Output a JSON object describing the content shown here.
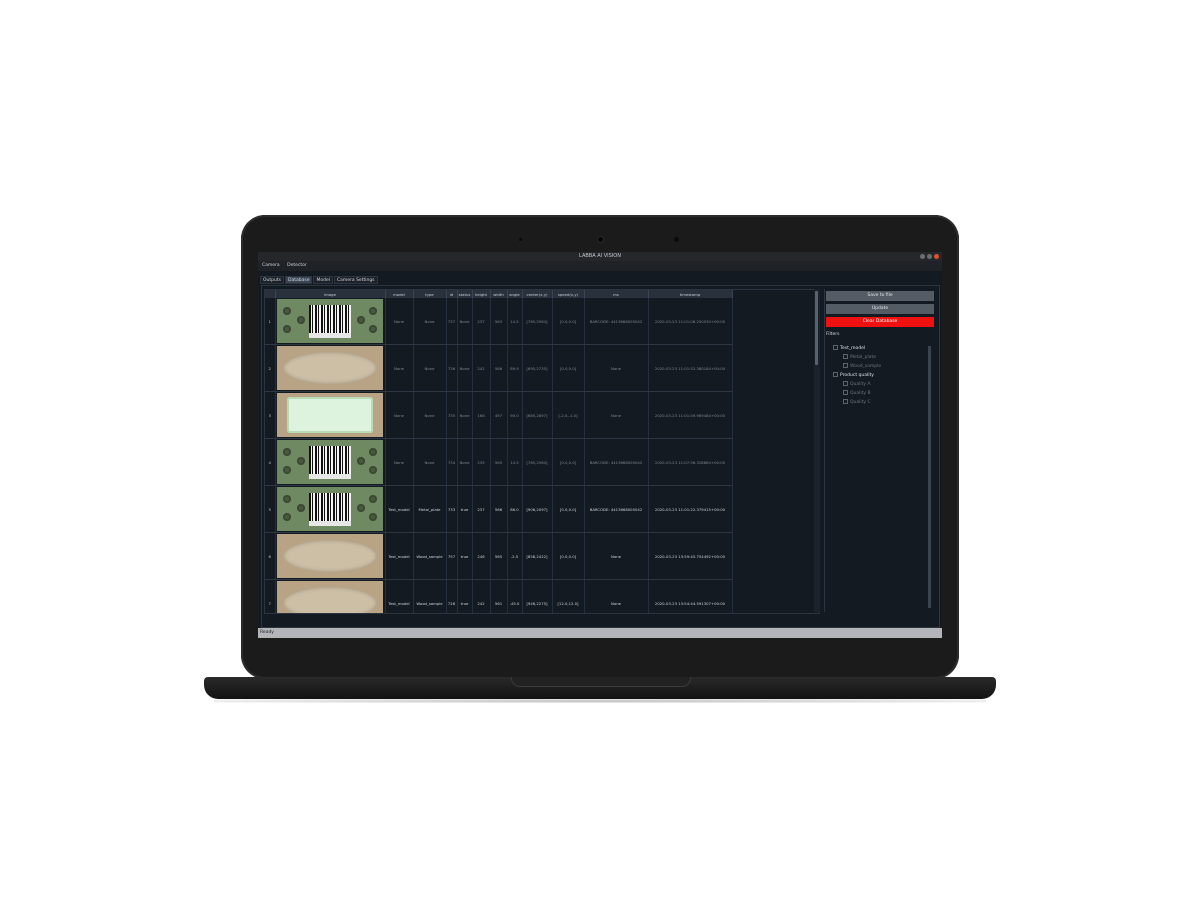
{
  "window": {
    "title": "LABBA AI VISION"
  },
  "menu": [
    "Camera",
    "Detector"
  ],
  "tabs": [
    {
      "label": "Outputs",
      "active": false
    },
    {
      "label": "Database",
      "active": true
    },
    {
      "label": "Model",
      "active": false
    },
    {
      "label": "Camera Settings",
      "active": false
    }
  ],
  "table": {
    "headers": [
      "",
      "image",
      "model",
      "type",
      "id",
      "status",
      "height",
      "width",
      "angle",
      "center(x,y)",
      "speed(x,y)",
      "ms",
      "timestamp"
    ],
    "rows": [
      {
        "n": "1",
        "img": "barcode",
        "model": "None",
        "type": "None",
        "id": "737",
        "status": "None",
        "height": "237",
        "width": "563",
        "angle": "14.5",
        "center": "[765,2564]",
        "speed": "[0.0,0.0]",
        "ms": "BARCODE: 4413668005042",
        "timestamp": "2020-03-23 11:01:06.250530+00:00"
      },
      {
        "n": "2",
        "img": "wood",
        "model": "None",
        "type": "None",
        "id": "736",
        "status": "None",
        "height": "242",
        "width": "586",
        "angle": "89.9",
        "center": "[695,2735]",
        "speed": "[0.0,0.0]",
        "ms": "None",
        "timestamp": "2020-03-23 11:01:52.380184+00:00"
      },
      {
        "n": "3",
        "img": "pale",
        "model": "None",
        "type": "None",
        "id": "735",
        "status": "None",
        "height": "168",
        "width": "497",
        "angle": "90.0",
        "center": "[685,2897]",
        "speed": "[-2.0,-1.0]",
        "ms": "None",
        "timestamp": "2020-03-23 11:01:49.969484+00:00"
      },
      {
        "n": "4",
        "img": "barcode",
        "model": "None",
        "type": "None",
        "id": "734",
        "status": "None",
        "height": "235",
        "width": "565",
        "angle": "14.5",
        "center": "[765,2564]",
        "speed": "[0.0,0.0]",
        "ms": "BARCODE: 4413668005042",
        "timestamp": "2020-03-23 11:07:56.328884+00:00"
      },
      {
        "n": "5",
        "img": "barcode",
        "model": "Test_model",
        "type": "Metal_plate",
        "id": "733",
        "status": "true",
        "height": "237",
        "width": "566",
        "angle": "86.0",
        "center": "[906,2097]",
        "speed": "[0.0,0.0]",
        "ms": "BARCODE: 4413668005042",
        "timestamp": "2020-03-23 11:01:22.379415+00:00"
      },
      {
        "n": "6",
        "img": "wood",
        "model": "Test_model",
        "type": "Wood_sample",
        "id": "757",
        "status": "true",
        "height": "246",
        "width": "565",
        "angle": "-2.5",
        "center": "[858,2422]",
        "speed": "[0.0,0.0]",
        "ms": "None",
        "timestamp": "2020-03-23 13:59:45.754492+00:00"
      },
      {
        "n": "7",
        "img": "wood",
        "model": "Test_model",
        "type": "Wood_sample",
        "id": "726",
        "status": "true",
        "height": "242",
        "width": "561",
        "angle": "-45.0",
        "center": "[946,2275]",
        "speed": "[12.0,12.0]",
        "ms": "None",
        "timestamp": "2020-03-23 13:54:44.591307+00:00"
      }
    ]
  },
  "sidebar": {
    "save_label": "Save to file",
    "update_label": "Update",
    "clear_label": "Clear Database",
    "filters_label": "Filters",
    "tree": [
      {
        "label": "Test_model",
        "children": [
          "Metal_plate",
          "Wood_sample"
        ]
      },
      {
        "label": "Product quality",
        "children": [
          "Quality A",
          "Quality B",
          "Quality C"
        ]
      }
    ]
  },
  "status": {
    "text": "Ready"
  },
  "colors": {
    "accent_red": "#ef1010",
    "background": "#141a22"
  }
}
